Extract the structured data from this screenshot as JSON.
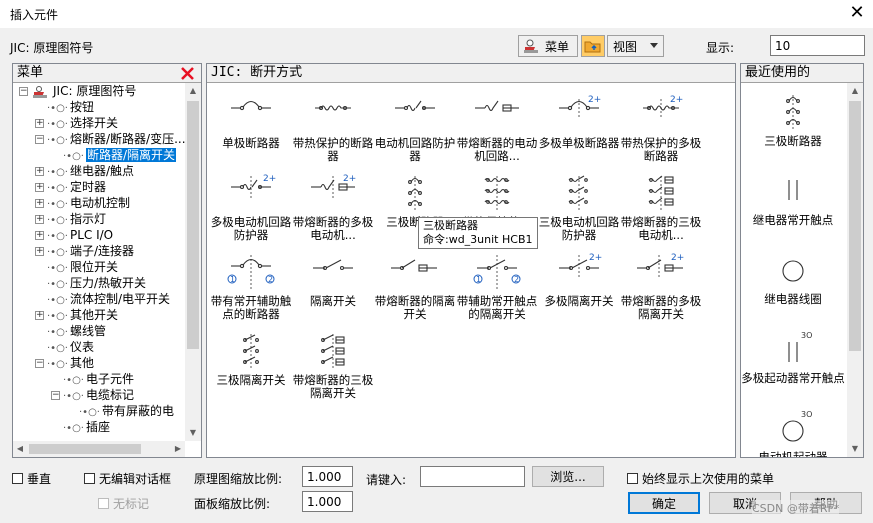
{
  "window": {
    "title": "插入元件",
    "close_glyph": "✕"
  },
  "header": {
    "library_label": "JIC: 原理图符号",
    "menu_button": "菜单",
    "view_button": "视图",
    "display_label": "显示:",
    "display_value": "10"
  },
  "menu_panel": {
    "title": "菜单",
    "tree": [
      {
        "label": "JIC: 原理图符号",
        "exp": "−",
        "level": 0,
        "root": true
      },
      {
        "label": "按钮",
        "exp": "",
        "level": 1
      },
      {
        "label": "选择开关",
        "exp": "+",
        "level": 1
      },
      {
        "label": "熔断器/断路器/变压...",
        "exp": "−",
        "level": 1
      },
      {
        "label": "断路器/隔离开关",
        "exp": "",
        "level": 2,
        "selected": true
      },
      {
        "label": "继电器/触点",
        "exp": "+",
        "level": 1
      },
      {
        "label": "定时器",
        "exp": "+",
        "level": 1
      },
      {
        "label": "电动机控制",
        "exp": "+",
        "level": 1
      },
      {
        "label": "指示灯",
        "exp": "+",
        "level": 1
      },
      {
        "label": "PLC I/O",
        "exp": "+",
        "level": 1
      },
      {
        "label": "端子/连接器",
        "exp": "+",
        "level": 1
      },
      {
        "label": "限位开关",
        "exp": "",
        "level": 1
      },
      {
        "label": "压力/热敏开关",
        "exp": "",
        "level": 1
      },
      {
        "label": "流体控制/电平开关",
        "exp": "",
        "level": 1
      },
      {
        "label": "其他开关",
        "exp": "+",
        "level": 1
      },
      {
        "label": "螺线管",
        "exp": "",
        "level": 1
      },
      {
        "label": "仪表",
        "exp": "",
        "level": 1
      },
      {
        "label": "其他",
        "exp": "−",
        "level": 1
      },
      {
        "label": "电子元件",
        "exp": "",
        "level": 2
      },
      {
        "label": "电缆标记",
        "exp": "−",
        "level": 2
      },
      {
        "label": "带有屏蔽的电",
        "exp": "",
        "level": 3
      },
      {
        "label": "插座",
        "exp": "",
        "level": 2
      }
    ]
  },
  "symbols_panel": {
    "title": "JIC: 断开方式",
    "items": [
      {
        "label": "单极断路器",
        "icon": "breaker-1p"
      },
      {
        "label": "带热保护的断路器",
        "icon": "breaker-thermal"
      },
      {
        "label": "电动机回路防护器",
        "icon": "motor-protector"
      },
      {
        "label": "带熔断器的电动机回路...",
        "icon": "fused-motor-protector"
      },
      {
        "label": "多极单极断路器",
        "icon": "breaker-multi"
      },
      {
        "label": "带热保护的多极断路器",
        "icon": "breaker-multi-thermal"
      },
      {
        "label": "多极电动机回路防护器",
        "icon": "motor-protector-multi"
      },
      {
        "label": "带熔断器的多极电动机...",
        "icon": "fused-motor-protector-multi"
      },
      {
        "label": "三极断路器",
        "icon": "breaker-3p"
      },
      {
        "label": "带热保护的三",
        "icon": "breaker-3p-thermal"
      },
      {
        "label": "三极电动机回路防护器",
        "icon": "motor-protector-3p"
      },
      {
        "label": "带熔断器的三极电动机...",
        "icon": "fused-motor-protector-3p"
      },
      {
        "label": "带有常开辅助触点的断路器",
        "icon": "breaker-aux"
      },
      {
        "label": "隔离开关",
        "icon": "disconnect"
      },
      {
        "label": "带熔断器的隔离开关",
        "icon": "fused-disconnect"
      },
      {
        "label": "带辅助常开触点的隔离开关",
        "icon": "disconnect-aux"
      },
      {
        "label": "多极隔离开关",
        "icon": "disconnect-multi"
      },
      {
        "label": "带熔断器的多极隔离开关",
        "icon": "fused-disconnect-multi"
      },
      {
        "label": "三极隔离开关",
        "icon": "disconnect-3p"
      },
      {
        "label": "带熔断器的三极隔离开关",
        "icon": "fused-disconnect-3p"
      }
    ],
    "tooltip": {
      "line1": "三极断路器",
      "line2": "命令:wd_3unit HCB1"
    },
    "badge_2plus": "2+",
    "aux_marks": [
      "1",
      "2"
    ]
  },
  "recent_panel": {
    "title": "最近使用的",
    "items": [
      {
        "label": "三极断路器",
        "icon": "breaker-3p"
      },
      {
        "label": "继电器常开触点",
        "icon": "relay-no"
      },
      {
        "label": "继电器线圈",
        "icon": "relay-coil"
      },
      {
        "label": "多极起动器常开触点",
        "icon": "starter-no"
      },
      {
        "label": "电动机起动器",
        "icon": "motor-starter"
      }
    ],
    "badge_3o": "3O"
  },
  "footer": {
    "vertical_label": "垂直",
    "no_dialog_label": "无编辑对话框",
    "no_tag_label": "无标记",
    "scale_label": "原理图缩放比例:",
    "scale_value": "1.000",
    "panel_scale_label": "面板缩放比例:",
    "panel_scale_value": "1.000",
    "type_label": "请键入:",
    "type_value": "",
    "browse_button": "浏览...",
    "always_show_label": "始终显示上次使用的菜单",
    "ok_button": "确定",
    "cancel_button": "取消",
    "help_button": "帮助",
    "watermark": "CSDN @带着RF*"
  },
  "colors": {
    "selection": "#0078d7",
    "close_red": "#e81123",
    "ok_border": "#0078d7"
  }
}
